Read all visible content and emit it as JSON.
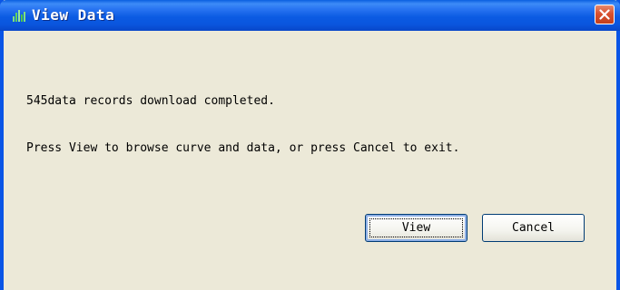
{
  "window": {
    "title": "View Data",
    "title_bar_color": "#0a55e6",
    "icon": "bar-chart-icon",
    "close_icon": "close-icon"
  },
  "message": {
    "line1": "545data records download completed.",
    "line2": "Press View to browse curve and data, or press Cancel to exit."
  },
  "buttons": {
    "view_label": "View",
    "cancel_label": "Cancel"
  }
}
